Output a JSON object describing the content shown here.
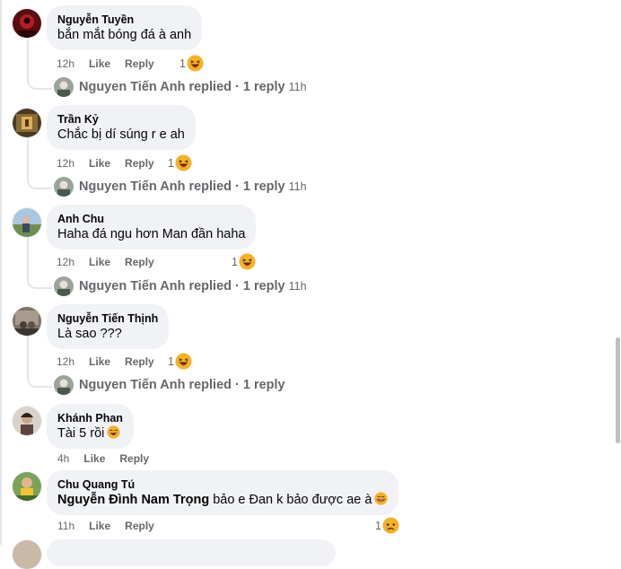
{
  "comments": [
    {
      "author": "Nguyễn Tuyền",
      "text": "bắn mắt bóng đá à anh",
      "time": "12h",
      "like": "Like",
      "reply": "Reply",
      "reaction_count": "1",
      "reaction_icon": "laughing-emoji",
      "reply_row": {
        "name": "Nguyen Tiến Anh replied",
        "count": "· 1 reply",
        "time": "11h"
      }
    },
    {
      "author": "Trần Kỷ",
      "text": "Chắc bị dí súng r e ah",
      "time": "12h",
      "like": "Like",
      "reply": "Reply",
      "reaction_count": "1",
      "reaction_icon": "laughing-emoji",
      "reply_row": {
        "name": "Nguyen Tiến Anh replied",
        "count": "· 1 reply",
        "time": "11h"
      }
    },
    {
      "author": "Anh Chu",
      "text": "Haha đá ngu hơn Man đần haha",
      "time": "12h",
      "like": "Like",
      "reply": "Reply",
      "reaction_count": "1",
      "reaction_icon": "laughing-emoji",
      "reply_row": {
        "name": "Nguyen Tiến Anh replied",
        "count": "· 1 reply",
        "time": "11h"
      }
    },
    {
      "author": "Nguyễn Tiến Thịnh",
      "text": "Là sao ???",
      "time": "12h",
      "like": "Like",
      "reply": "Reply",
      "reaction_count": "1",
      "reaction_icon": "laughing-emoji",
      "reply_row": {
        "name": "Nguyen Tiến Anh replied",
        "count": "· 1 reply",
        "time": ""
      }
    },
    {
      "author": "Khánh Phan",
      "text": "Tài 5 rồi",
      "text_emoji": "rolling-laughing-emoji",
      "time": "4h",
      "like": "Like",
      "reply": "Reply"
    },
    {
      "author": "Chu Quang Tú",
      "mention": "Nguyễn Đình Nam Trọng",
      "text": "bảo e Đan k bảo được ae à",
      "text_emoji": "grinning-emoji",
      "time": "11h",
      "like": "Like",
      "reply": "Reply",
      "reaction_count": "1",
      "reaction_icon": "sad-emoji"
    }
  ],
  "colors": {
    "bubble": "#f0f2f5",
    "meta": "#65676b",
    "text": "#050505",
    "thread_line": "#e4e6eb"
  }
}
